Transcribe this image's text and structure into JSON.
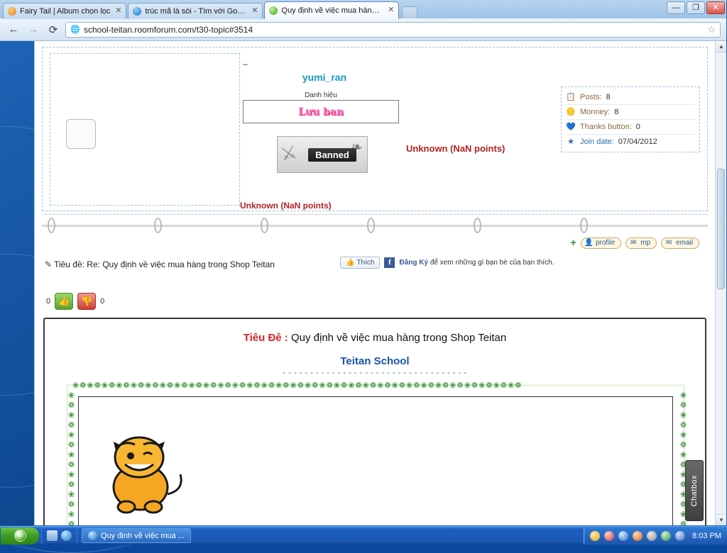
{
  "browser": {
    "tabs": [
      {
        "title": "Fairy Tail | Album chọn lọc",
        "favicon": "orange-favicon",
        "close": "✕",
        "active": false
      },
      {
        "title": "trúc mã là sói - Tìm với Google",
        "favicon": "blue-favicon",
        "close": "✕",
        "active": false
      },
      {
        "title": "Quy định về việc mua hàng tro",
        "favicon": "green-favicon",
        "close": "✕",
        "active": true
      }
    ],
    "new_tab_label": "+",
    "window_controls": {
      "minimize": "—",
      "maximize": "❐",
      "close": "✕"
    },
    "toolbar": {
      "back": "←",
      "forward": "→",
      "reload": "⟳",
      "url": "school-teitan.roomforum.com/t30-topic#3514",
      "lock_icon": "globe-icon",
      "star": "☆"
    }
  },
  "post": {
    "dash": "–",
    "username": "yumi_ran",
    "rank_label": "Danh hiệu",
    "rank_text": "Lưu ban",
    "banned_text": "Banned",
    "unknown_right": "Unknown (NaN points)",
    "unknown_bottom": "Unknown (NaN points)",
    "stats": [
      {
        "icon": "note-icon",
        "key": "Posts:",
        "value": "8"
      },
      {
        "icon": "coin-icon",
        "key": "Monney:",
        "value": "8"
      },
      {
        "icon": "heart-icon",
        "key": "Thanks button:",
        "value": "0"
      },
      {
        "icon": "star-icon",
        "key": "Join date:",
        "value": "07/04/2012"
      }
    ],
    "buttons": [
      {
        "label": "profile",
        "icon": "profile-icon"
      },
      {
        "label": "mp",
        "icon": "mail-icon"
      },
      {
        "label": "email",
        "icon": "email-icon"
      }
    ],
    "plus_icon": "+",
    "subject": "Tiêu đề: Re: Quy định về việc mua hàng trong Shop Teitan",
    "subject_icon": "pencil-icon",
    "facebook": {
      "like_label": "Thích",
      "like_icon": "thumbs-up-icon",
      "f_badge": "f",
      "text_bold": "Đăng Ký",
      "text_rest": "để xem những gì bạn bè của bạn thích."
    },
    "vote": {
      "up_count": "0",
      "down_count": "0",
      "up_icon": "thumbs-up-icon",
      "down_icon": "thumbs-down-icon"
    }
  },
  "content": {
    "title_prefix": "Tiêu Đê :",
    "title_rest": "Quy định về việc mua hàng trong Shop Teitan",
    "subtitle": "Teitan School",
    "divider": "- - - - - - - - - - - - - - - - - - - - - - - - - - - - - - - - - -",
    "image_alt": "cartoon-cat-image"
  },
  "chatbox": {
    "label": "Chatbox"
  },
  "scrollbar": {
    "up": "▲",
    "down": "▼"
  },
  "taskbar": {
    "start_label": "start-orb",
    "quick_icons": [
      "show-desktop-icon",
      "browser-icon"
    ],
    "task_button": {
      "label": "Quy định về việc mua ...",
      "icon": "browser-icon"
    },
    "tray_icons": [
      "messenger-icon",
      "antivirus-icon",
      "network-icon",
      "media-icon",
      "volume-icon",
      "shield-icon",
      "language-icon"
    ],
    "clock": "8:03 PM"
  }
}
